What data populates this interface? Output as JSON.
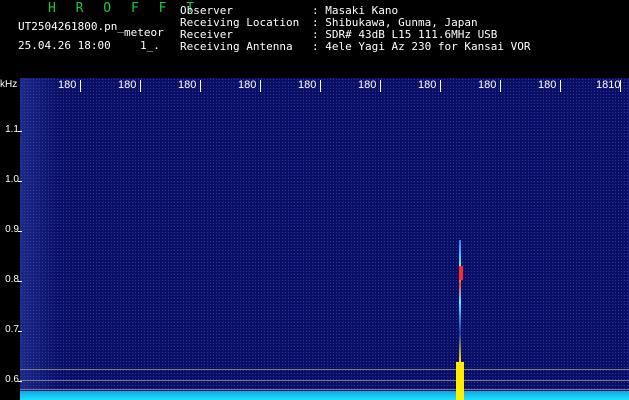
{
  "header": {
    "brand": "H R O F F T",
    "filename": "UT2504261800.pn_",
    "meteor_label": "meteor",
    "timestamp": "25.04.26 18:00",
    "index_text": "1_.",
    "observer_key": "Observer",
    "observer_val": ": Masaki Kano",
    "location_key": "Receiving Location",
    "location_val": ": Shibukawa, Gunma, Japan",
    "receiver_key": "Receiver",
    "receiver_val": ": SDR# 43dB L15 111.6MHz USB",
    "antenna_key": "Receiving Antenna",
    "antenna_val": ": 4ele Yagi Az 230 for Kansai VOR"
  },
  "axes": {
    "y_unit": "kHz",
    "y_ticks": [
      "1.1",
      "1.0",
      "0.9",
      "0.8",
      "0.7",
      "0.6"
    ],
    "x_ticks": [
      "180",
      "180",
      "180",
      "180",
      "180",
      "180",
      "180",
      "180",
      "180",
      "1810"
    ]
  },
  "colors": {
    "background": "#0a0e62",
    "brand": "#19c742",
    "baseline": "#1de0ff",
    "meteor_hot": "#ff2a2a",
    "meteor_base": "#ffea00"
  }
}
